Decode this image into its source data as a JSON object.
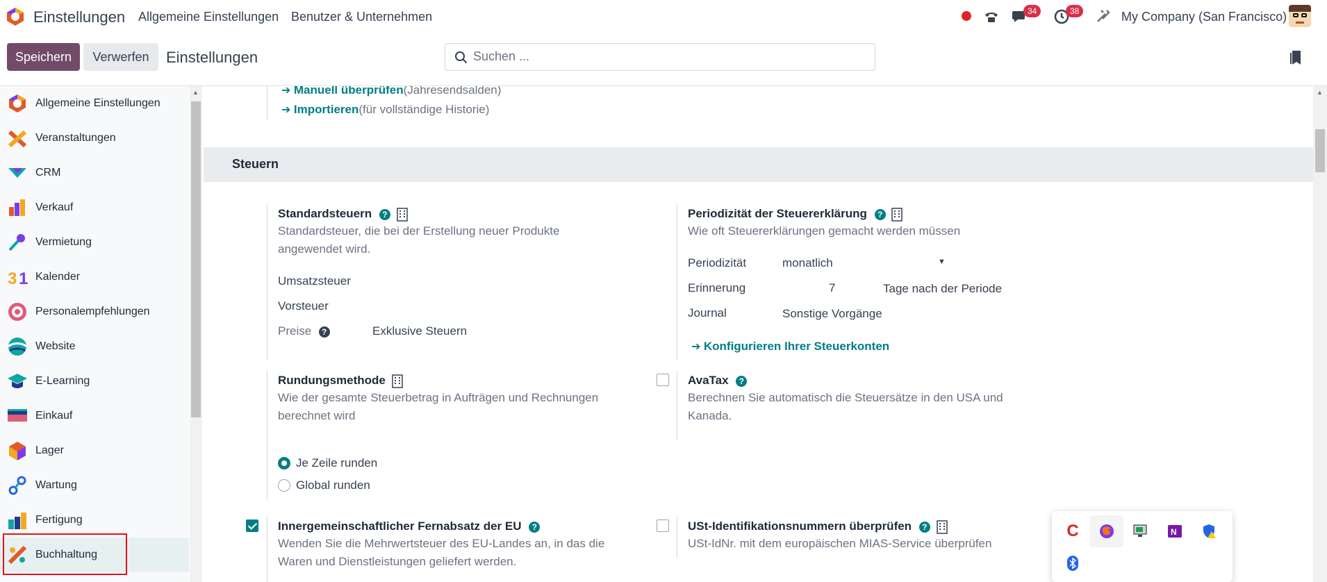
{
  "topbar": {
    "app_name": "Einstellungen",
    "menu": [
      "Allgemeine Einstellungen",
      "Benutzer & Unternehmen"
    ],
    "messages_count": "34",
    "activities_count": "38",
    "company": "My Company (San Francisco)"
  },
  "controlbar": {
    "save_label": "Speichern",
    "discard_label": "Verwerfen",
    "title": "Einstellungen",
    "search_placeholder": "Suchen ..."
  },
  "sidebar": {
    "items": [
      {
        "label": "Allgemeine Einstellungen",
        "icon": "settings-app-icon"
      },
      {
        "label": "Veranstaltungen",
        "icon": "events-app-icon"
      },
      {
        "label": "CRM",
        "icon": "crm-app-icon"
      },
      {
        "label": "Verkauf",
        "icon": "sales-app-icon"
      },
      {
        "label": "Vermietung",
        "icon": "rental-app-icon"
      },
      {
        "label": "Kalender",
        "icon": "calendar-app-icon"
      },
      {
        "label": "Personalempfehlungen",
        "icon": "referrals-app-icon"
      },
      {
        "label": "Website",
        "icon": "website-app-icon"
      },
      {
        "label": "E-Learning",
        "icon": "elearning-app-icon"
      },
      {
        "label": "Einkauf",
        "icon": "purchase-app-icon"
      },
      {
        "label": "Lager",
        "icon": "inventory-app-icon"
      },
      {
        "label": "Wartung",
        "icon": "maintenance-app-icon"
      },
      {
        "label": "Fertigung",
        "icon": "manufacturing-app-icon"
      },
      {
        "label": "Buchhaltung",
        "icon": "accounting-app-icon"
      }
    ],
    "active": "Buchhaltung"
  },
  "top_links": {
    "manual_link": "Manuell überprüfen",
    "manual_note": "(Jahresendsalden)",
    "import_link": "Importieren",
    "import_note": "(für vollständige Historie)"
  },
  "section": {
    "title": "Steuern"
  },
  "default_taxes": {
    "title": "Standardsteuern",
    "desc": "Standardsteuer, die bei der Erstellung neuer Produkte angewendet wird.",
    "sales_tax_label": "Umsatzsteuer",
    "purchase_tax_label": "Vorsteuer",
    "prices_label": "Preise",
    "prices_value": "Exklusive Steuern"
  },
  "tax_periodicity": {
    "title": "Periodizität der Steuererklärung",
    "desc": "Wie oft Steuererklärungen gemacht werden müssen",
    "periodicity_label": "Periodizität",
    "periodicity_value": "monatlich",
    "reminder_label": "Erinnerung",
    "reminder_value": "7",
    "reminder_suffix": "Tage nach der Periode",
    "journal_label": "Journal",
    "journal_value": "Sonstige Vorgänge",
    "config_link": "Konfigurieren Ihrer Steuerkonten"
  },
  "rounding": {
    "title": "Rundungsmethode",
    "desc": "Wie der gesamte Steuerbetrag in Aufträgen und Rechnungen berechnet wird",
    "options": [
      "Je Zeile runden",
      "Global runden"
    ],
    "selected": "Je Zeile runden"
  },
  "avatax": {
    "title": "AvaTax",
    "desc": "Berechnen Sie automatisch die Steuersätze in den USA und Kanada.",
    "checked": false
  },
  "eu_distance": {
    "title": "Innergemeinschaftlicher Fernabsatz der EU",
    "desc": "Wenden Sie die Mehrwertsteuer des EU-Landes an, in das die Waren und Dienstleistungen geliefert werden.",
    "checked": true
  },
  "vat_check": {
    "title": "USt-Identifikationsnummern überprüfen",
    "desc": "USt-IdNr. mit dem europäischen MIAS-Service überprüfen",
    "checked": false
  },
  "colors": {
    "primary": "#714b67",
    "accent": "#017e84",
    "badge": "#d9304a",
    "highlight": "#e0131b"
  }
}
